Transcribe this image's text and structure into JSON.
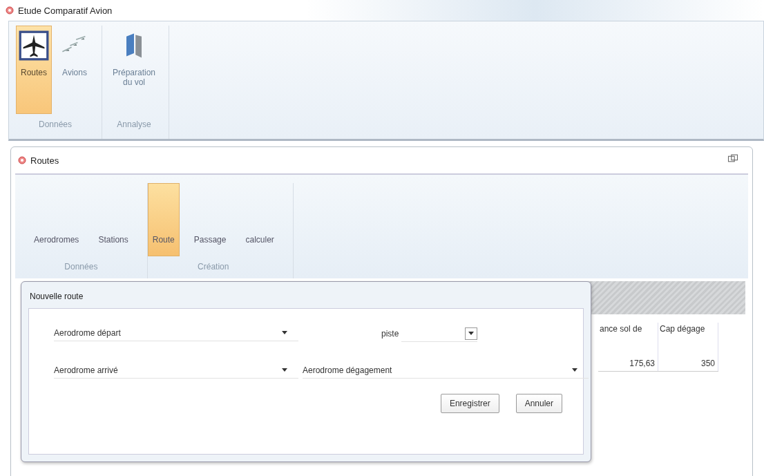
{
  "window": {
    "title": "Etude Comparatif Avion"
  },
  "ribbon": {
    "groups": [
      {
        "label": "Données",
        "buttons": [
          {
            "label": "Routes",
            "kind": "plane-box",
            "selected": true
          },
          {
            "label": "Avions",
            "kind": "planes",
            "selected": false
          }
        ]
      },
      {
        "label": "Annalyse",
        "buttons": [
          {
            "label": "Préparation du vol",
            "kind": "book",
            "selected": false
          }
        ]
      }
    ]
  },
  "child_window": {
    "title": "Routes",
    "ribbon": {
      "groups": [
        {
          "label": "Données",
          "buttons": [
            {
              "label": "Aerodromes",
              "selected": false
            },
            {
              "label": "Stations",
              "selected": false
            }
          ]
        },
        {
          "label": "Création",
          "buttons": [
            {
              "label": "Route",
              "selected": true
            },
            {
              "label": "Passage",
              "selected": false
            },
            {
              "label": "calculer",
              "selected": false
            }
          ]
        }
      ]
    },
    "table": {
      "columns": [
        "ance sol de",
        "Cap dégage"
      ],
      "rows": [
        [
          "175,63",
          "350"
        ]
      ]
    }
  },
  "dialog": {
    "title": "Nouvelle route",
    "fields": [
      {
        "label": "Aerodrome départ",
        "kind": "combo"
      },
      {
        "label": "piste",
        "kind": "small-combo"
      },
      {
        "label": "Aerodrome arrivé",
        "kind": "combo"
      },
      {
        "label": "Aerodrome dégagement",
        "kind": "combo"
      }
    ],
    "buttons": [
      "Enregistrer",
      "Annuler"
    ]
  }
}
